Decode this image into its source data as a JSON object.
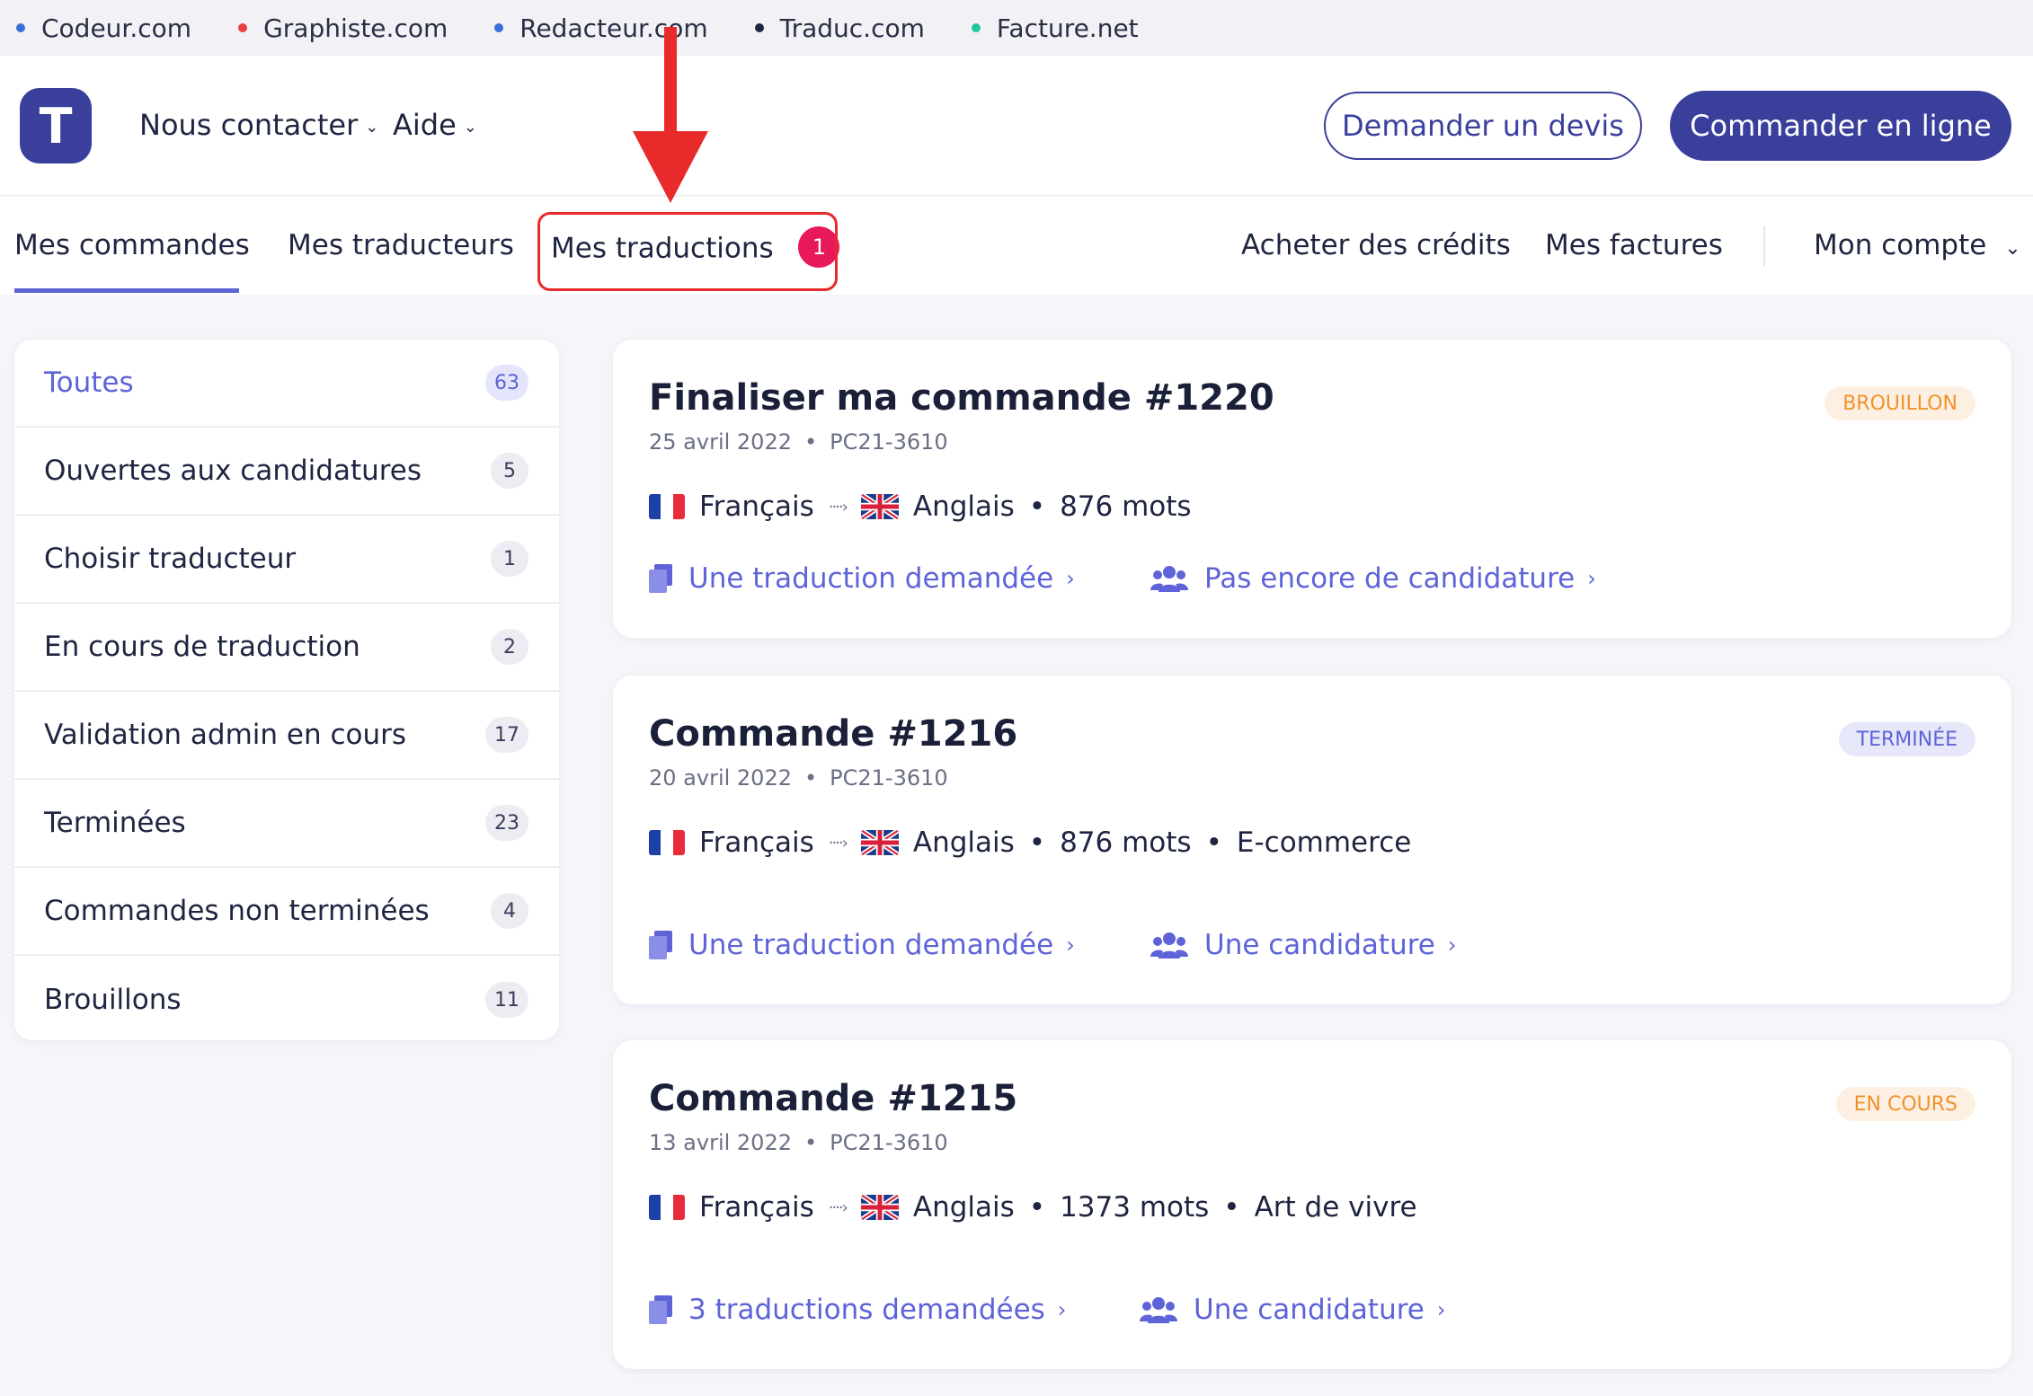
{
  "topbar": {
    "sites": [
      {
        "label": "Codeur.com",
        "color": "#3a6fd8"
      },
      {
        "label": "Graphiste.com",
        "color": "#e84040"
      },
      {
        "label": "Redacteur.com",
        "color": "#3a6fd8"
      },
      {
        "label": "Traduc.com",
        "color": "#1f2540"
      },
      {
        "label": "Facture.net",
        "color": "#22c7a0"
      }
    ]
  },
  "header": {
    "logo_letter": "T",
    "menu": [
      {
        "label": "Nous contacter"
      },
      {
        "label": "Aide"
      }
    ],
    "quote_button": "Demander un devis",
    "order_button": "Commander en ligne"
  },
  "tabs": {
    "left": [
      {
        "label": "Mes commandes",
        "active": true
      },
      {
        "label": "Mes traducteurs"
      },
      {
        "label": "Mes traductions",
        "badge": "1"
      }
    ],
    "right": [
      {
        "label": "Acheter des crédits"
      },
      {
        "label": "Mes factures"
      },
      {
        "label": "Mon compte"
      }
    ]
  },
  "sidebar": {
    "items": [
      {
        "label": "Toutes",
        "count": "63"
      },
      {
        "label": "Ouvertes aux candidatures",
        "count": "5"
      },
      {
        "label": "Choisir traducteur",
        "count": "1"
      },
      {
        "label": "En cours de traduction",
        "count": "2"
      },
      {
        "label": "Validation admin en cours",
        "count": "17"
      },
      {
        "label": "Terminées",
        "count": "23"
      },
      {
        "label": "Commandes non terminées",
        "count": "4"
      },
      {
        "label": "Brouillons",
        "count": "11"
      }
    ]
  },
  "orders": [
    {
      "title": "Finaliser ma commande #1220",
      "date": "25 avril 2022",
      "ref": "PC21-3610",
      "status": "BROUILLON",
      "source_lang": "Français",
      "target_lang": "Anglais",
      "words": "876 mots",
      "category": "",
      "translations_link": "Une traduction demandée",
      "applications_link": "Pas encore de candidature"
    },
    {
      "title": "Commande #1216",
      "date": "20 avril 2022",
      "ref": "PC21-3610",
      "status": "TERMINÉE",
      "source_lang": "Français",
      "target_lang": "Anglais",
      "words": "876 mots",
      "category": "E-commerce",
      "translations_link": "Une traduction demandée",
      "applications_link": "Une candidature"
    },
    {
      "title": "Commande #1215",
      "date": "13 avril 2022",
      "ref": "PC21-3610",
      "status": "EN COURS",
      "source_lang": "Français",
      "target_lang": "Anglais",
      "words": "1373 mots",
      "category": "Art de vivre",
      "translations_link": "3 traductions demandées",
      "applications_link": "Une candidature"
    }
  ],
  "separators": {
    "dot": "•",
    "bullet": "•",
    "lang_arrow": "····›",
    "chevron": "›"
  },
  "colors": {
    "brand": "#3a3f9c",
    "accent": "#5e63d8",
    "badge": "#e8195a",
    "annotation": "#e82a2a"
  }
}
